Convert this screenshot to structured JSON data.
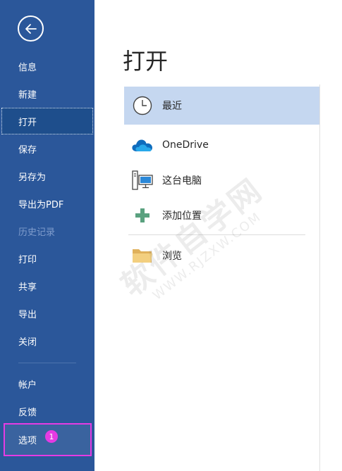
{
  "sidebar": {
    "back_icon": "arrow-left-icon",
    "items": [
      {
        "label": "信息"
      },
      {
        "label": "新建"
      },
      {
        "label": "打开"
      },
      {
        "label": "保存"
      },
      {
        "label": "另存为"
      },
      {
        "label": "导出为PDF"
      },
      {
        "label": "历史记录"
      },
      {
        "label": "打印"
      },
      {
        "label": "共享"
      },
      {
        "label": "导出"
      },
      {
        "label": "关闭"
      }
    ],
    "bottom_items": [
      {
        "label": "帐户"
      },
      {
        "label": "反馈"
      },
      {
        "label": "选项"
      }
    ],
    "badge": "1"
  },
  "main": {
    "title": "打开",
    "locations": [
      {
        "label": "最近",
        "icon": "clock-icon"
      },
      {
        "label": "OneDrive",
        "icon": "cloud-icon"
      },
      {
        "label": "这台电脑",
        "icon": "computer-icon"
      },
      {
        "label": "添加位置",
        "icon": "plus-icon"
      },
      {
        "label": "浏览",
        "icon": "folder-icon"
      }
    ]
  },
  "watermark": {
    "main": "软件自学网",
    "sub": "WWW.RJZXW.COM"
  },
  "colors": {
    "sidebar_bg": "#2b579a",
    "selected_location_bg": "#c5d7f0",
    "highlight_box": "#e53be3"
  }
}
